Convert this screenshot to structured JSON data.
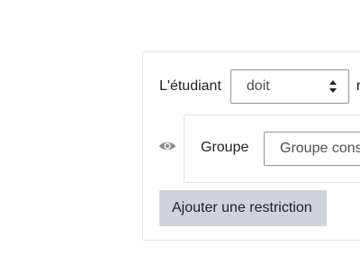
{
  "restriction": {
    "student_label": "L'étudiant",
    "must_select": {
      "value": "doit",
      "icon": "updown-arrows-icon"
    },
    "trailing_text": "r",
    "condition": {
      "visibility_icon": "eye-icon",
      "group_label": "Groupe",
      "group_select_value": "Groupe cons"
    },
    "add_button_label": "Ajouter une restriction"
  },
  "colors": {
    "border": "#dee2e6",
    "select_border": "#8f959e",
    "button_bg": "#ced4da",
    "eye_icon": "#868e96"
  }
}
